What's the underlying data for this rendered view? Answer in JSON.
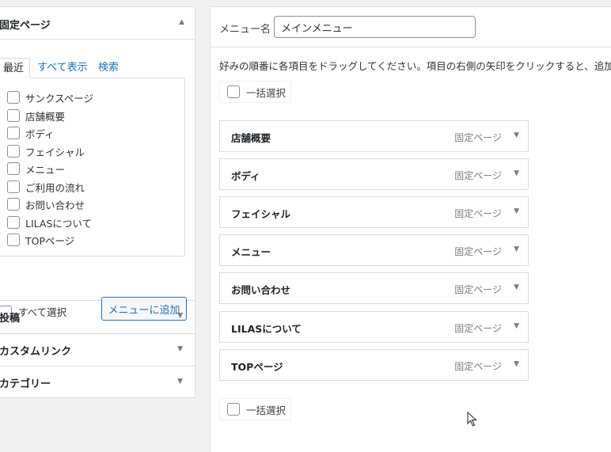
{
  "left": {
    "pages_section": {
      "title": "固定ページ",
      "tabs": [
        {
          "label": "最近"
        },
        {
          "label": "すべて表示"
        },
        {
          "label": "検索"
        }
      ],
      "items": [
        {
          "label": "サンクスページ"
        },
        {
          "label": "店舗概要"
        },
        {
          "label": "ボディ"
        },
        {
          "label": "フェイシャル"
        },
        {
          "label": "メニュー"
        },
        {
          "label": "ご利用の流れ"
        },
        {
          "label": "お問い合わせ"
        },
        {
          "label": "LILASについて"
        },
        {
          "label": "TOPページ"
        }
      ],
      "select_all_label": "すべて選択",
      "add_button_label": "メニューに追加"
    },
    "sections": [
      {
        "title": "投稿"
      },
      {
        "title": "カスタムリンク"
      },
      {
        "title": "カテゴリー"
      }
    ],
    "collapse_icon": "triangle-up-icon",
    "expand_icon": "triangle-down-icon"
  },
  "main": {
    "menu_name_label": "メニュー名",
    "menu_name_value": "メインメニュー",
    "instructions": "好みの順番に各項目をドラッグしてください。項目の右側の矢印をクリックすると、追加設",
    "bulk_select_label": "一括選択",
    "menu_items": [
      {
        "name": "店舗概要",
        "type": "固定ページ"
      },
      {
        "name": "ボディ",
        "type": "固定ページ"
      },
      {
        "name": "フェイシャル",
        "type": "固定ページ"
      },
      {
        "name": "メニュー",
        "type": "固定ページ"
      },
      {
        "name": "お問い合わせ",
        "type": "固定ページ"
      },
      {
        "name": "LILASについて",
        "type": "固定ページ"
      },
      {
        "name": "TOPページ",
        "type": "固定ページ"
      }
    ]
  },
  "colors": {
    "link": "#2271b1",
    "border": "#dcdcde",
    "background": "#f0f0f1"
  }
}
